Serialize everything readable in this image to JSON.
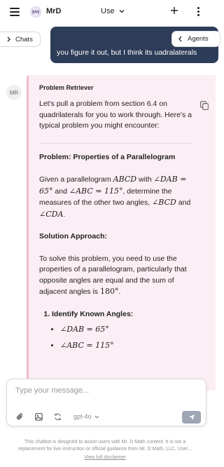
{
  "header": {
    "brand": "MrD",
    "model_select": "Use",
    "icons": [
      "menu-icon",
      "logo-icon",
      "chevron-down-icon",
      "plus-icon",
      "more-vertical-icon"
    ]
  },
  "nav": {
    "chats_label": "Chats",
    "agents_label": "Agents"
  },
  "user_message": {
    "text": "you figure it out, but I think its uadralaterals"
  },
  "assistant": {
    "avatar_initials": "MR",
    "name": "Problem Retriever",
    "intro": "Let's pull a problem from section 6.4 on quadrilaterals for you to work through. Here's a typical problem you might encounter:",
    "problem_heading": "Problem: Properties of a Parallelogram",
    "problem_text_1": "Given a parallelogram",
    "problem_shape": "ABCD",
    "problem_text_2": "with",
    "angle_dab": "∠DAB = 65°",
    "and_1": "and",
    "angle_abc": "∠ABC = 115°",
    "problem_text_3": ", determine the measures of the other two angles,",
    "angle_bcd": "∠BCD",
    "and_2": "and",
    "angle_cda": "∠CDA",
    "period": ".",
    "solution_heading": "Solution Approach:",
    "solution_text": "To solve this problem, you need to use the properties of a parallelogram, particularly that opposite angles are equal and the sum of adjacent angles is",
    "solution_value": "180°",
    "solution_end": ".",
    "steps": [
      {
        "label": "Identify Known Angles:",
        "bullets": [
          "∠DAB = 65°",
          "∠ABC = 115°"
        ]
      }
    ]
  },
  "composer": {
    "placeholder": "Type your message...",
    "model": "gpt-4o",
    "icons": [
      "paperclip-icon",
      "image-icon",
      "refresh-icon",
      "send-icon"
    ]
  },
  "footer": {
    "disclaimer": "This chatbot is designed to assist users with Mr. D Math content. It is not a replacement for live instruction or official guidance from Mr. D Math, LLC. User...",
    "link": "View full disclaimer"
  }
}
